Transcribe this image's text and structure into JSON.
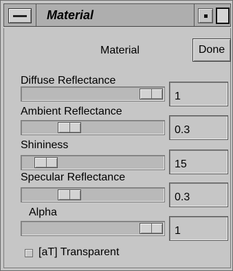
{
  "window": {
    "title": "Material"
  },
  "panel": {
    "title": "Material",
    "done_label": "Done"
  },
  "sliders": [
    {
      "label": "Diffuse Reflectance",
      "value": "1",
      "fraction": 1.0
    },
    {
      "label": "Ambient Reflectance",
      "value": "0.3",
      "fraction": 0.3
    },
    {
      "label": "Shininess",
      "value": "15",
      "fraction": 0.1
    },
    {
      "label": "Specular Reflectance",
      "value": "0.3",
      "fraction": 0.3
    },
    {
      "label": "Alpha",
      "value": "1",
      "fraction": 1.0
    }
  ],
  "transparent": {
    "label": "[aT] Transparent",
    "checked": false
  },
  "icons": {
    "window_menu": "window-menu-icon",
    "minimize": "minimize-icon",
    "maximize": "maximize-icon"
  }
}
